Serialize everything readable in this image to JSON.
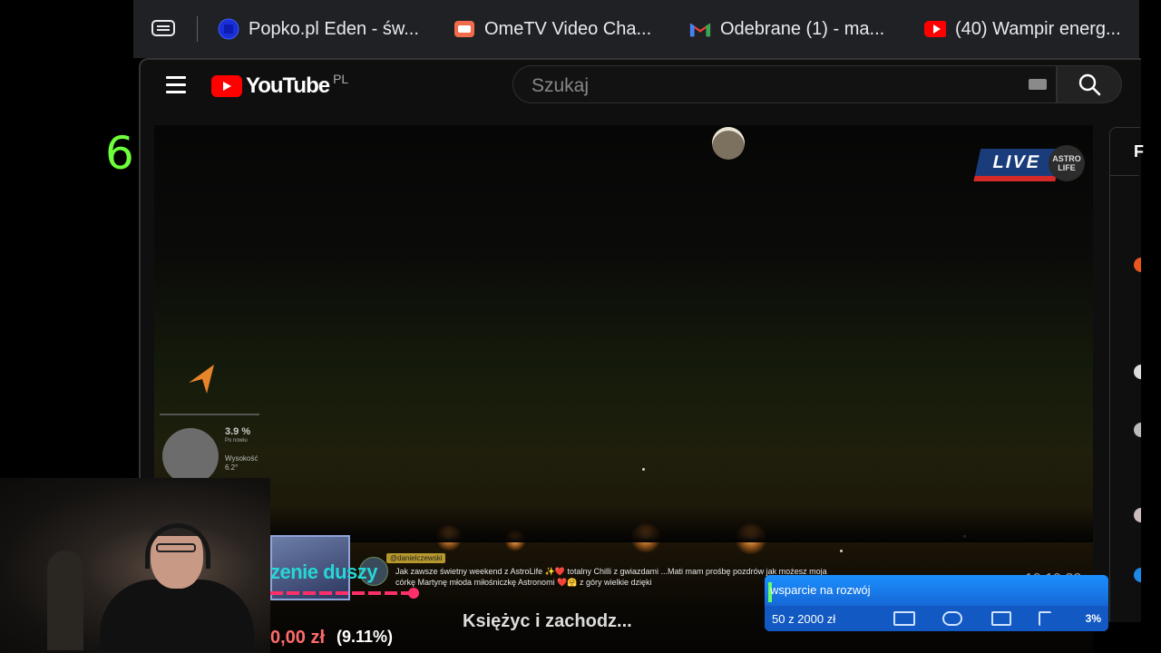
{
  "counter": "6",
  "browser": {
    "tabs": [
      {
        "label": "Popko.pl Eden - św...",
        "icon": "globe-blue-icon"
      },
      {
        "label": "OmeTV Video Cha...",
        "icon": "ometv-icon"
      },
      {
        "label": "Odebrane (1) - ma...",
        "icon": "gmail-icon"
      },
      {
        "label": "(40) Wampir energ...",
        "icon": "youtube-icon"
      }
    ]
  },
  "youtube": {
    "logo_text": "YouTube",
    "region": "PL",
    "search_placeholder": "Szukaj"
  },
  "video": {
    "live_label": "LIVE",
    "brand_line1": "ASTRO",
    "brand_line2": "LIFE",
    "moon_percent": "3.9 %",
    "moon_sub": "Po nowiu",
    "altitude_label": "Wysokość",
    "altitude_value": "6.2°",
    "donor_tag": "@danielczewski",
    "chat_message": "Jak zawsze świetny weekend z AstroLife ✨❤️ totalny Chilli z gwiazdami ...Mati mam prośbę pozdrów jak możesz moja córkę Martynę młoda miłośniczkę Astronomi ❤️🤗 z góry wielkie dzięki",
    "next_title": "Księżyc i zachodz..."
  },
  "overlay": {
    "goal_text": "zenie duszy",
    "amount": "0,00 zł",
    "percent": "(9.11%)",
    "clock": "19:19:32",
    "support_title": "wsparcie na rozwój",
    "support_amount": "50 z 2000 zł",
    "support_percent": "3%"
  },
  "right_panel": {
    "letter": "F"
  },
  "colors": {
    "counter": "#6dff3a",
    "youtube_red": "#ff0000",
    "support_blue": "#1a73e8",
    "goal_cyan": "#27d6d6"
  }
}
